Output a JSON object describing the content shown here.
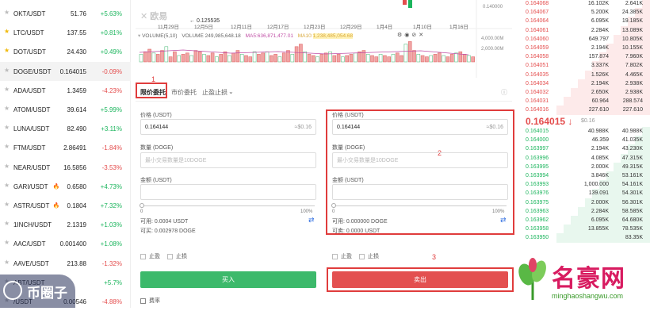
{
  "sidebar": {
    "pairs": [
      {
        "symbol": "OKT/USDT",
        "price": "51.76",
        "change": "+5.63%",
        "dir": "up",
        "fav": false,
        "hot": false
      },
      {
        "symbol": "LTC/USDT",
        "price": "137.55",
        "change": "+0.81%",
        "dir": "up",
        "fav": true,
        "hot": false
      },
      {
        "symbol": "DOT/USDT",
        "price": "24.430",
        "change": "+0.49%",
        "dir": "up",
        "fav": true,
        "hot": false
      },
      {
        "symbol": "DOGE/USDT",
        "price": "0.164015",
        "change": "-0.09%",
        "dir": "down",
        "fav": false,
        "hot": false
      },
      {
        "symbol": "ADA/USDT",
        "price": "1.3459",
        "change": "-4.23%",
        "dir": "down",
        "fav": false,
        "hot": false
      },
      {
        "symbol": "ATOM/USDT",
        "price": "39.614",
        "change": "+5.99%",
        "dir": "up",
        "fav": false,
        "hot": false
      },
      {
        "symbol": "LUNA/USDT",
        "price": "82.490",
        "change": "+3.11%",
        "dir": "up",
        "fav": false,
        "hot": false
      },
      {
        "symbol": "FTM/USDT",
        "price": "2.86491",
        "change": "-1.84%",
        "dir": "down",
        "fav": false,
        "hot": false
      },
      {
        "symbol": "NEAR/USDT",
        "price": "16.5856",
        "change": "-3.53%",
        "dir": "down",
        "fav": false,
        "hot": false
      },
      {
        "symbol": "GARI/USDT",
        "price": "0.6580",
        "change": "+4.73%",
        "dir": "up",
        "fav": false,
        "hot": true
      },
      {
        "symbol": "ASTR/USDT",
        "price": "0.1804",
        "change": "+7.32%",
        "dir": "up",
        "fav": false,
        "hot": true
      },
      {
        "symbol": "1INCH/USDT",
        "price": "2.1319",
        "change": "+1.03%",
        "dir": "up",
        "fav": false,
        "hot": false
      },
      {
        "symbol": "AAC/USDT",
        "price": "0.001400",
        "change": "+1.08%",
        "dir": "up",
        "fav": false,
        "hot": false
      },
      {
        "symbol": "AAVE/USDT",
        "price": "213.88",
        "change": "-1.32%",
        "dir": "down",
        "fav": false,
        "hot": false
      },
      {
        "symbol": "ABT/USDT",
        "price": "",
        "change": "+5.7%",
        "dir": "up",
        "fav": false,
        "hot": false
      },
      {
        "symbol": "/USDT",
        "price": "0.00546",
        "change": "-4.88%",
        "dir": "down",
        "fav": false,
        "hot": false
      }
    ]
  },
  "chart": {
    "low_marker": "← 0.125535",
    "dates": [
      "11月29日",
      "12月5日",
      "12月11日",
      "12月17日",
      "12月23日",
      "12月29日",
      "1月4日",
      "1月10日",
      "1月16日"
    ],
    "price_axis_label": "0.140000",
    "volume_header": {
      "title": "VOLUME(5,10)",
      "volume_label": "VOLUME",
      "volume_value": "249,985,648.18",
      "ma5_label": "MA5:",
      "ma5_value": "636,871,477.01",
      "ma10_label": "MA10:",
      "ma10_value": "1,238,485,054.68"
    },
    "volume_axis": [
      "4,000.00M",
      "2,000.00M"
    ],
    "logo_text": "欧易"
  },
  "trade": {
    "tabs": [
      "限价委托",
      "市价委托",
      "止盈止损"
    ],
    "active_tab": 0,
    "buy": {
      "price_label": "价格 (USDT)",
      "price_value": "0.164144",
      "price_fiat": "≈$0.16",
      "qty_label": "数量 (DOGE)",
      "qty_placeholder": "最小交易数量是10DOGE",
      "amount_label": "金额 (USDT)",
      "slider_min": "0",
      "slider_max": "100%",
      "avail": "可用: 0.0004 USDT",
      "can_buy": "可买: 0.002978 DOGE",
      "tp": "止盈",
      "sl": "止损",
      "button": "买入",
      "fee": "费率"
    },
    "sell": {
      "price_label": "价格 (USDT)",
      "price_value": "0.164144",
      "price_fiat": "≈$0.16",
      "qty_label": "数量 (DOGE)",
      "qty_placeholder": "最小交易数量是10DOGE",
      "amount_label": "金额 (USDT)",
      "slider_min": "0",
      "slider_max": "100%",
      "avail": "可用: 0.000000 DOGE",
      "can_sell": "可卖: 0.0000 USDT",
      "tp": "止盈",
      "sl": "止损",
      "button": "卖出"
    },
    "annotations": [
      "1",
      "2",
      "3"
    ]
  },
  "orderbook": {
    "asks": [
      {
        "p": "0.164068",
        "a": "16.102K",
        "t": "2.641K"
      },
      {
        "p": "0.164067",
        "a": "5.200K",
        "t": "24.385K"
      },
      {
        "p": "0.164064",
        "a": "6.095K",
        "t": "19.185K"
      },
      {
        "p": "0.164061",
        "a": "2.284K",
        "t": "13.089K"
      },
      {
        "p": "0.164060",
        "a": "649.797",
        "t": "10.805K"
      },
      {
        "p": "0.164059",
        "a": "2.194K",
        "t": "10.155K"
      },
      {
        "p": "0.164058",
        "a": "157.874",
        "t": "7.960K"
      },
      {
        "p": "0.164051",
        "a": "3.337K",
        "t": "7.802K"
      },
      {
        "p": "0.164035",
        "a": "1.526K",
        "t": "4.465K"
      },
      {
        "p": "0.164034",
        "a": "2.194K",
        "t": "2.938K"
      },
      {
        "p": "0.164032",
        "a": "2.650K",
        "t": "2.938K"
      },
      {
        "p": "0.164031",
        "a": "60.964",
        "t": "288.574"
      },
      {
        "p": "0.164016",
        "a": "227.610",
        "t": "227.610"
      }
    ],
    "last_price": "0.164015",
    "last_arrow": "↓",
    "last_fiat": "$0.16",
    "bids": [
      {
        "p": "0.164015",
        "a": "40.988K",
        "t": "40.988K"
      },
      {
        "p": "0.164000",
        "a": "46.359",
        "t": "41.035K"
      },
      {
        "p": "0.163997",
        "a": "2.194K",
        "t": "43.230K"
      },
      {
        "p": "0.163996",
        "a": "4.085K",
        "t": "47.315K"
      },
      {
        "p": "0.163995",
        "a": "2.000K",
        "t": "49.315K"
      },
      {
        "p": "0.163994",
        "a": "3.846K",
        "t": "53.161K"
      },
      {
        "p": "0.163993",
        "a": "1,000.000",
        "t": "54.161K"
      },
      {
        "p": "0.163976",
        "a": "139.091",
        "t": "54.301K"
      },
      {
        "p": "0.163975",
        "a": "2.000K",
        "t": "56.301K"
      },
      {
        "p": "0.163963",
        "a": "2.284K",
        "t": "58.585K"
      },
      {
        "p": "0.163962",
        "a": "6.095K",
        "t": "64.680K"
      },
      {
        "p": "0.163958",
        "a": "13.855K",
        "t": "78.535K"
      },
      {
        "p": "0.163950",
        "a": "",
        "t": "83.35K"
      }
    ]
  },
  "watermarks": {
    "left": "币圈子",
    "right_main": "名豪网",
    "right_sub": "minghaoshangwu.com"
  },
  "colors": {
    "up": "#1cb55d",
    "down": "#e44d4d",
    "annotation": "#e03c3c",
    "buy": "#3cb96b",
    "sell": "#e35050"
  }
}
